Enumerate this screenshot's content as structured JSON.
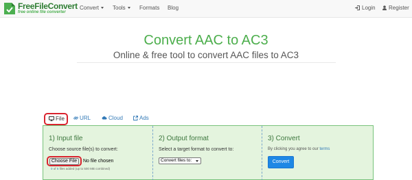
{
  "brand": {
    "name": "FreeFileConvert",
    "tagline": "free online file converter",
    "color": "#2e7d32"
  },
  "nav": {
    "convert": "Convert",
    "tools": "Tools",
    "formats": "Formats",
    "blog": "Blog",
    "login": "Login",
    "register": "Register"
  },
  "hero": {
    "title": "Convert AAC to AC3",
    "subtitle": "Online & free tool to convert AAC files to AC3"
  },
  "tabs": [
    {
      "label": "File",
      "icon": "monitor-icon"
    },
    {
      "label": "URL",
      "icon": "link-icon"
    },
    {
      "label": "Cloud",
      "icon": "cloud-icon"
    },
    {
      "label": "Ads",
      "icon": "external-link-icon"
    }
  ],
  "steps": {
    "input": {
      "heading": "1) Input file",
      "instruction": "Choose source file(s) to convert:",
      "button": "Choose File",
      "status": "No file chosen",
      "count": "0",
      "of": "of",
      "max": "5",
      "note": "files added (up to 500 MB combined)"
    },
    "output": {
      "heading": "2) Output format",
      "instruction": "Select a target format to convert to:",
      "select_value": "Convert files to:"
    },
    "convert": {
      "heading": "3) Convert",
      "agree_text": "By clicking you agree to our",
      "terms_link": "terms",
      "button": "Convert"
    }
  },
  "colors": {
    "accent_green": "#4cae4c",
    "panel_bg": "#e4f4de",
    "highlight_red": "#d9232e",
    "button_blue": "#1e88e5",
    "link_blue": "#337ab7"
  }
}
